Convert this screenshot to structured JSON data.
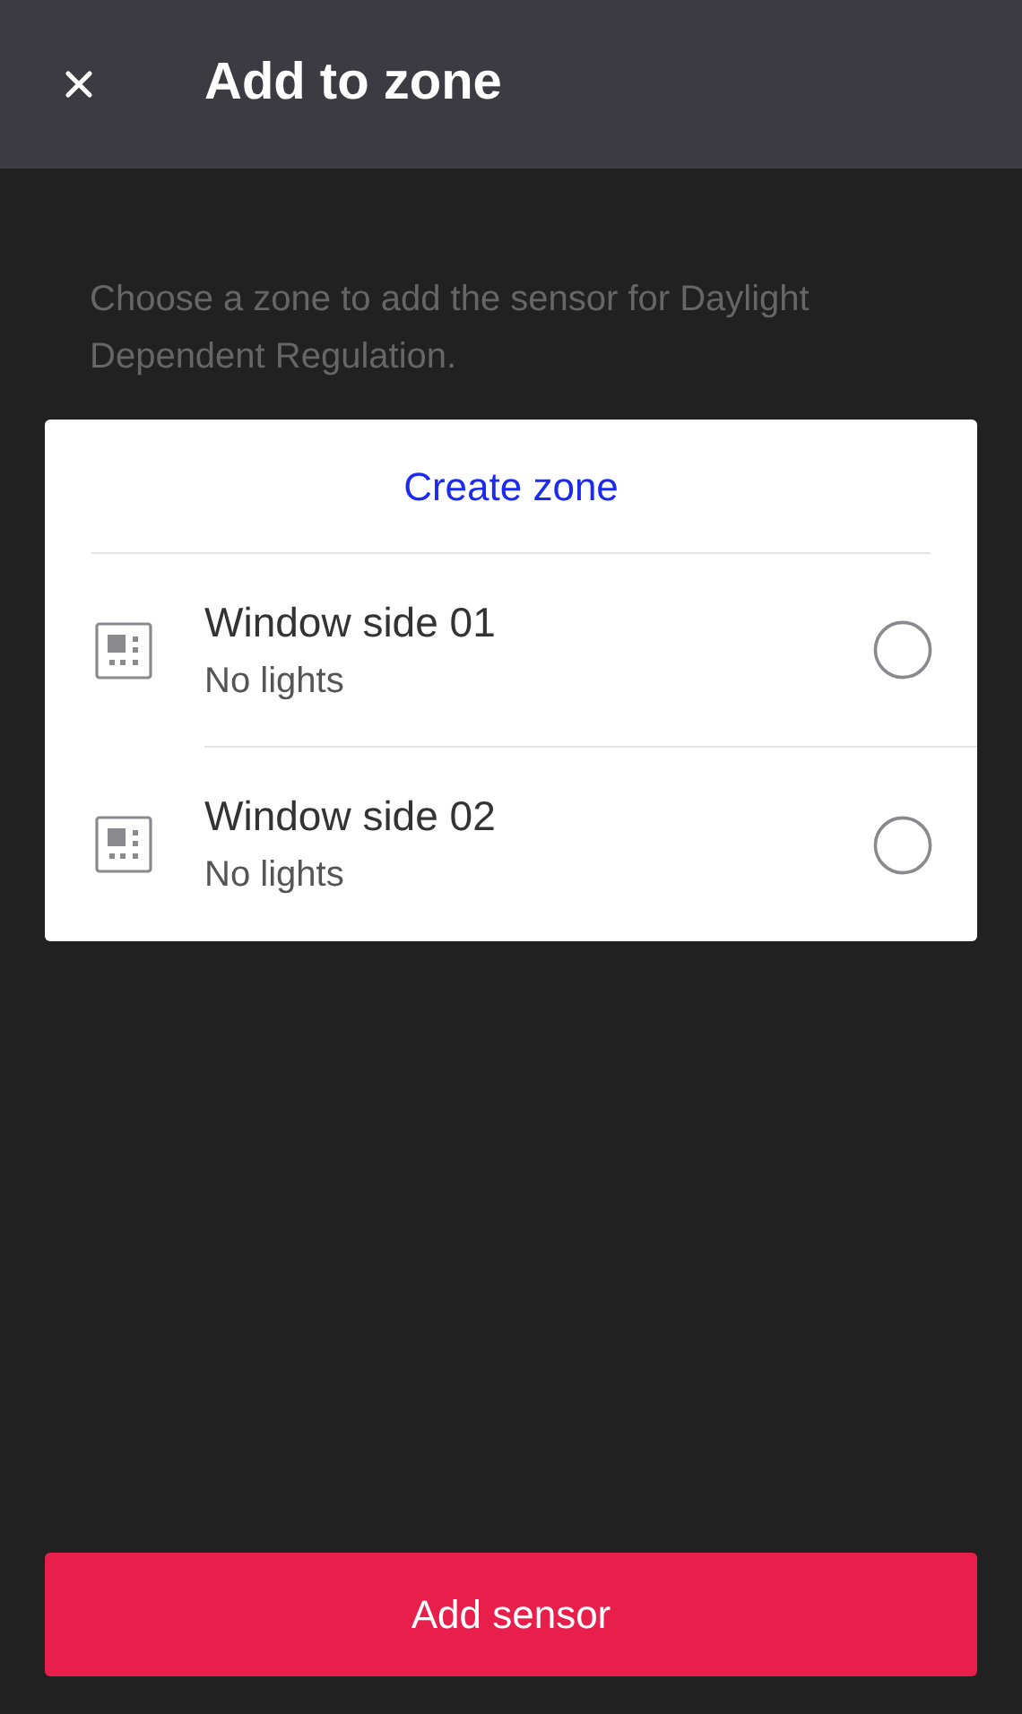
{
  "header": {
    "title": "Add to zone"
  },
  "description": "Choose a zone to add the sensor for Daylight Dependent Regulation.",
  "create_zone": "Create zone",
  "zones": [
    {
      "name": "Window side 01",
      "subtitle": "No lights",
      "selected": false
    },
    {
      "name": "Window side 02",
      "subtitle": "No lights",
      "selected": false
    }
  ],
  "primary_button": "Add sensor"
}
